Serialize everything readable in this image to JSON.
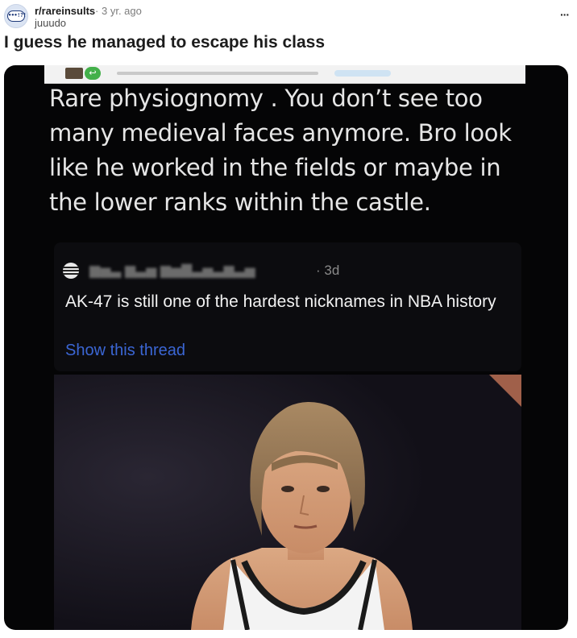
{
  "post": {
    "subreddit": "r/rareinsults",
    "separator": "·",
    "age": "3 yr. ago",
    "author": "juuudo",
    "more_label": "···",
    "title": "I guess he managed to escape his class"
  },
  "image": {
    "tweet_lines": [
      "Rare physiognomy . You don’t see too",
      "many medieval faces anymore. Bro look",
      "like he worked in the fields or maybe in",
      "the lower ranks within the castle."
    ],
    "quoted": {
      "time": "· 3d",
      "text": "AK-47 is still one of the hardest nicknames in NBA history",
      "link": "Show this thread"
    },
    "colors": {
      "background": "#050506",
      "link": "#3b66d4",
      "verified": "#43b04a"
    }
  }
}
